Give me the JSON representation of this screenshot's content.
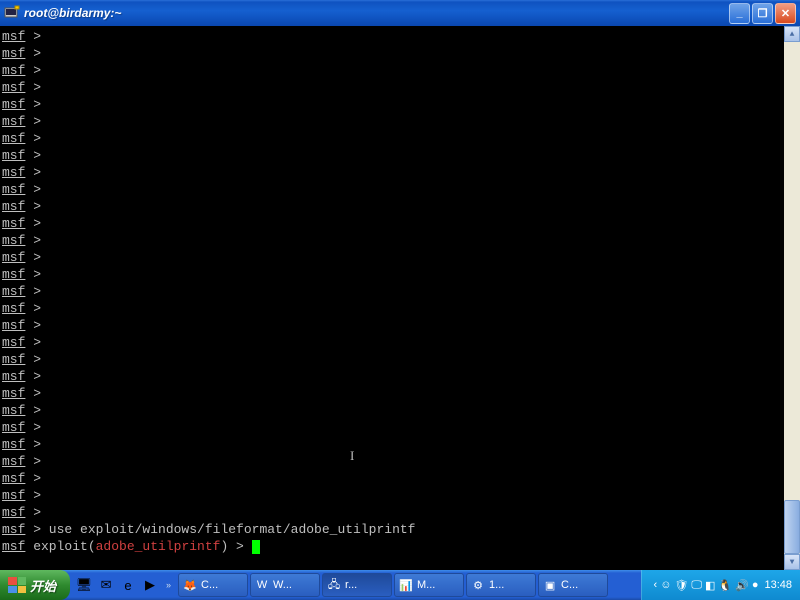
{
  "window": {
    "title": "root@birdarmy:~",
    "min_label": "_",
    "max_label": "❐",
    "close_label": "✕"
  },
  "terminal": {
    "prompt_module": "msf",
    "prompt_char": ">",
    "empty_line_count": 29,
    "command": "use exploit/windows/fileformat/adobe_utilprintf",
    "last_prompt_prefix": "msf",
    "last_prompt_word": "exploit",
    "last_prompt_paren_open": "(",
    "last_prompt_context": "adobe_utilprintf",
    "last_prompt_paren_close": ")",
    "last_prompt_char": ">"
  },
  "taskbar": {
    "start_label": "开始",
    "quicklaunch": [
      {
        "name": "show-desktop-icon",
        "glyph": "🖥"
      },
      {
        "name": "outlook-icon",
        "glyph": "✉"
      },
      {
        "name": "ie-icon",
        "glyph": "e"
      },
      {
        "name": "player-icon",
        "glyph": "▶"
      }
    ],
    "tasks": [
      {
        "name": "firefox-task",
        "icon": "🦊",
        "label": "C..."
      },
      {
        "name": "word-task",
        "icon": "W",
        "label": "W..."
      },
      {
        "name": "putty-task",
        "icon": "🖧",
        "label": "r...",
        "active": true
      },
      {
        "name": "app1-task",
        "icon": "📊",
        "label": "M..."
      },
      {
        "name": "app2-task",
        "icon": "⚙",
        "label": "1..."
      },
      {
        "name": "console-task",
        "icon": "▣",
        "label": "C..."
      }
    ],
    "tray": [
      {
        "name": "chevron-left-icon",
        "glyph": "‹"
      },
      {
        "name": "im-icon",
        "glyph": "☺"
      },
      {
        "name": "shield-icon",
        "glyph": "🛡"
      },
      {
        "name": "display-icon",
        "glyph": "🖵"
      },
      {
        "name": "net-icon",
        "glyph": "◧"
      },
      {
        "name": "qq-icon",
        "glyph": "🐧"
      },
      {
        "name": "volume-icon",
        "glyph": "🔊"
      },
      {
        "name": "alert-icon",
        "glyph": "●"
      }
    ],
    "clock": "13:48"
  }
}
